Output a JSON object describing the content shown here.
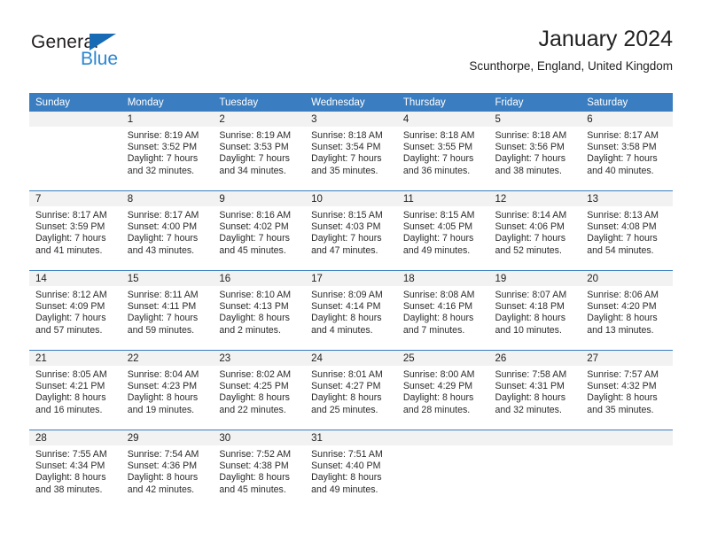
{
  "brand": {
    "name_part1": "General",
    "name_part2": "Blue",
    "triangle_color": "#176bb5",
    "blue_color": "#2a86d0"
  },
  "header": {
    "title": "January 2024",
    "subtitle": "Scunthorpe, England, United Kingdom"
  },
  "theme": {
    "header_bg": "#3a7dc0",
    "daynum_band_bg": "#f2f2f2",
    "grid_line": "#3a7dc0"
  },
  "weekday_headers": [
    "Sunday",
    "Monday",
    "Tuesday",
    "Wednesday",
    "Thursday",
    "Friday",
    "Saturday"
  ],
  "weeks": [
    [
      {
        "day": "",
        "sunrise": "",
        "sunset": "",
        "daylight_line1": "",
        "daylight_line2": ""
      },
      {
        "day": "1",
        "sunrise": "Sunrise: 8:19 AM",
        "sunset": "Sunset: 3:52 PM",
        "daylight_line1": "Daylight: 7 hours",
        "daylight_line2": "and 32 minutes."
      },
      {
        "day": "2",
        "sunrise": "Sunrise: 8:19 AM",
        "sunset": "Sunset: 3:53 PM",
        "daylight_line1": "Daylight: 7 hours",
        "daylight_line2": "and 34 minutes."
      },
      {
        "day": "3",
        "sunrise": "Sunrise: 8:18 AM",
        "sunset": "Sunset: 3:54 PM",
        "daylight_line1": "Daylight: 7 hours",
        "daylight_line2": "and 35 minutes."
      },
      {
        "day": "4",
        "sunrise": "Sunrise: 8:18 AM",
        "sunset": "Sunset: 3:55 PM",
        "daylight_line1": "Daylight: 7 hours",
        "daylight_line2": "and 36 minutes."
      },
      {
        "day": "5",
        "sunrise": "Sunrise: 8:18 AM",
        "sunset": "Sunset: 3:56 PM",
        "daylight_line1": "Daylight: 7 hours",
        "daylight_line2": "and 38 minutes."
      },
      {
        "day": "6",
        "sunrise": "Sunrise: 8:17 AM",
        "sunset": "Sunset: 3:58 PM",
        "daylight_line1": "Daylight: 7 hours",
        "daylight_line2": "and 40 minutes."
      }
    ],
    [
      {
        "day": "7",
        "sunrise": "Sunrise: 8:17 AM",
        "sunset": "Sunset: 3:59 PM",
        "daylight_line1": "Daylight: 7 hours",
        "daylight_line2": "and 41 minutes."
      },
      {
        "day": "8",
        "sunrise": "Sunrise: 8:17 AM",
        "sunset": "Sunset: 4:00 PM",
        "daylight_line1": "Daylight: 7 hours",
        "daylight_line2": "and 43 minutes."
      },
      {
        "day": "9",
        "sunrise": "Sunrise: 8:16 AM",
        "sunset": "Sunset: 4:02 PM",
        "daylight_line1": "Daylight: 7 hours",
        "daylight_line2": "and 45 minutes."
      },
      {
        "day": "10",
        "sunrise": "Sunrise: 8:15 AM",
        "sunset": "Sunset: 4:03 PM",
        "daylight_line1": "Daylight: 7 hours",
        "daylight_line2": "and 47 minutes."
      },
      {
        "day": "11",
        "sunrise": "Sunrise: 8:15 AM",
        "sunset": "Sunset: 4:05 PM",
        "daylight_line1": "Daylight: 7 hours",
        "daylight_line2": "and 49 minutes."
      },
      {
        "day": "12",
        "sunrise": "Sunrise: 8:14 AM",
        "sunset": "Sunset: 4:06 PM",
        "daylight_line1": "Daylight: 7 hours",
        "daylight_line2": "and 52 minutes."
      },
      {
        "day": "13",
        "sunrise": "Sunrise: 8:13 AM",
        "sunset": "Sunset: 4:08 PM",
        "daylight_line1": "Daylight: 7 hours",
        "daylight_line2": "and 54 minutes."
      }
    ],
    [
      {
        "day": "14",
        "sunrise": "Sunrise: 8:12 AM",
        "sunset": "Sunset: 4:09 PM",
        "daylight_line1": "Daylight: 7 hours",
        "daylight_line2": "and 57 minutes."
      },
      {
        "day": "15",
        "sunrise": "Sunrise: 8:11 AM",
        "sunset": "Sunset: 4:11 PM",
        "daylight_line1": "Daylight: 7 hours",
        "daylight_line2": "and 59 minutes."
      },
      {
        "day": "16",
        "sunrise": "Sunrise: 8:10 AM",
        "sunset": "Sunset: 4:13 PM",
        "daylight_line1": "Daylight: 8 hours",
        "daylight_line2": "and 2 minutes."
      },
      {
        "day": "17",
        "sunrise": "Sunrise: 8:09 AM",
        "sunset": "Sunset: 4:14 PM",
        "daylight_line1": "Daylight: 8 hours",
        "daylight_line2": "and 4 minutes."
      },
      {
        "day": "18",
        "sunrise": "Sunrise: 8:08 AM",
        "sunset": "Sunset: 4:16 PM",
        "daylight_line1": "Daylight: 8 hours",
        "daylight_line2": "and 7 minutes."
      },
      {
        "day": "19",
        "sunrise": "Sunrise: 8:07 AM",
        "sunset": "Sunset: 4:18 PM",
        "daylight_line1": "Daylight: 8 hours",
        "daylight_line2": "and 10 minutes."
      },
      {
        "day": "20",
        "sunrise": "Sunrise: 8:06 AM",
        "sunset": "Sunset: 4:20 PM",
        "daylight_line1": "Daylight: 8 hours",
        "daylight_line2": "and 13 minutes."
      }
    ],
    [
      {
        "day": "21",
        "sunrise": "Sunrise: 8:05 AM",
        "sunset": "Sunset: 4:21 PM",
        "daylight_line1": "Daylight: 8 hours",
        "daylight_line2": "and 16 minutes."
      },
      {
        "day": "22",
        "sunrise": "Sunrise: 8:04 AM",
        "sunset": "Sunset: 4:23 PM",
        "daylight_line1": "Daylight: 8 hours",
        "daylight_line2": "and 19 minutes."
      },
      {
        "day": "23",
        "sunrise": "Sunrise: 8:02 AM",
        "sunset": "Sunset: 4:25 PM",
        "daylight_line1": "Daylight: 8 hours",
        "daylight_line2": "and 22 minutes."
      },
      {
        "day": "24",
        "sunrise": "Sunrise: 8:01 AM",
        "sunset": "Sunset: 4:27 PM",
        "daylight_line1": "Daylight: 8 hours",
        "daylight_line2": "and 25 minutes."
      },
      {
        "day": "25",
        "sunrise": "Sunrise: 8:00 AM",
        "sunset": "Sunset: 4:29 PM",
        "daylight_line1": "Daylight: 8 hours",
        "daylight_line2": "and 28 minutes."
      },
      {
        "day": "26",
        "sunrise": "Sunrise: 7:58 AM",
        "sunset": "Sunset: 4:31 PM",
        "daylight_line1": "Daylight: 8 hours",
        "daylight_line2": "and 32 minutes."
      },
      {
        "day": "27",
        "sunrise": "Sunrise: 7:57 AM",
        "sunset": "Sunset: 4:32 PM",
        "daylight_line1": "Daylight: 8 hours",
        "daylight_line2": "and 35 minutes."
      }
    ],
    [
      {
        "day": "28",
        "sunrise": "Sunrise: 7:55 AM",
        "sunset": "Sunset: 4:34 PM",
        "daylight_line1": "Daylight: 8 hours",
        "daylight_line2": "and 38 minutes."
      },
      {
        "day": "29",
        "sunrise": "Sunrise: 7:54 AM",
        "sunset": "Sunset: 4:36 PM",
        "daylight_line1": "Daylight: 8 hours",
        "daylight_line2": "and 42 minutes."
      },
      {
        "day": "30",
        "sunrise": "Sunrise: 7:52 AM",
        "sunset": "Sunset: 4:38 PM",
        "daylight_line1": "Daylight: 8 hours",
        "daylight_line2": "and 45 minutes."
      },
      {
        "day": "31",
        "sunrise": "Sunrise: 7:51 AM",
        "sunset": "Sunset: 4:40 PM",
        "daylight_line1": "Daylight: 8 hours",
        "daylight_line2": "and 49 minutes."
      },
      {
        "day": "",
        "sunrise": "",
        "sunset": "",
        "daylight_line1": "",
        "daylight_line2": ""
      },
      {
        "day": "",
        "sunrise": "",
        "sunset": "",
        "daylight_line1": "",
        "daylight_line2": ""
      },
      {
        "day": "",
        "sunrise": "",
        "sunset": "",
        "daylight_line1": "",
        "daylight_line2": ""
      }
    ]
  ]
}
